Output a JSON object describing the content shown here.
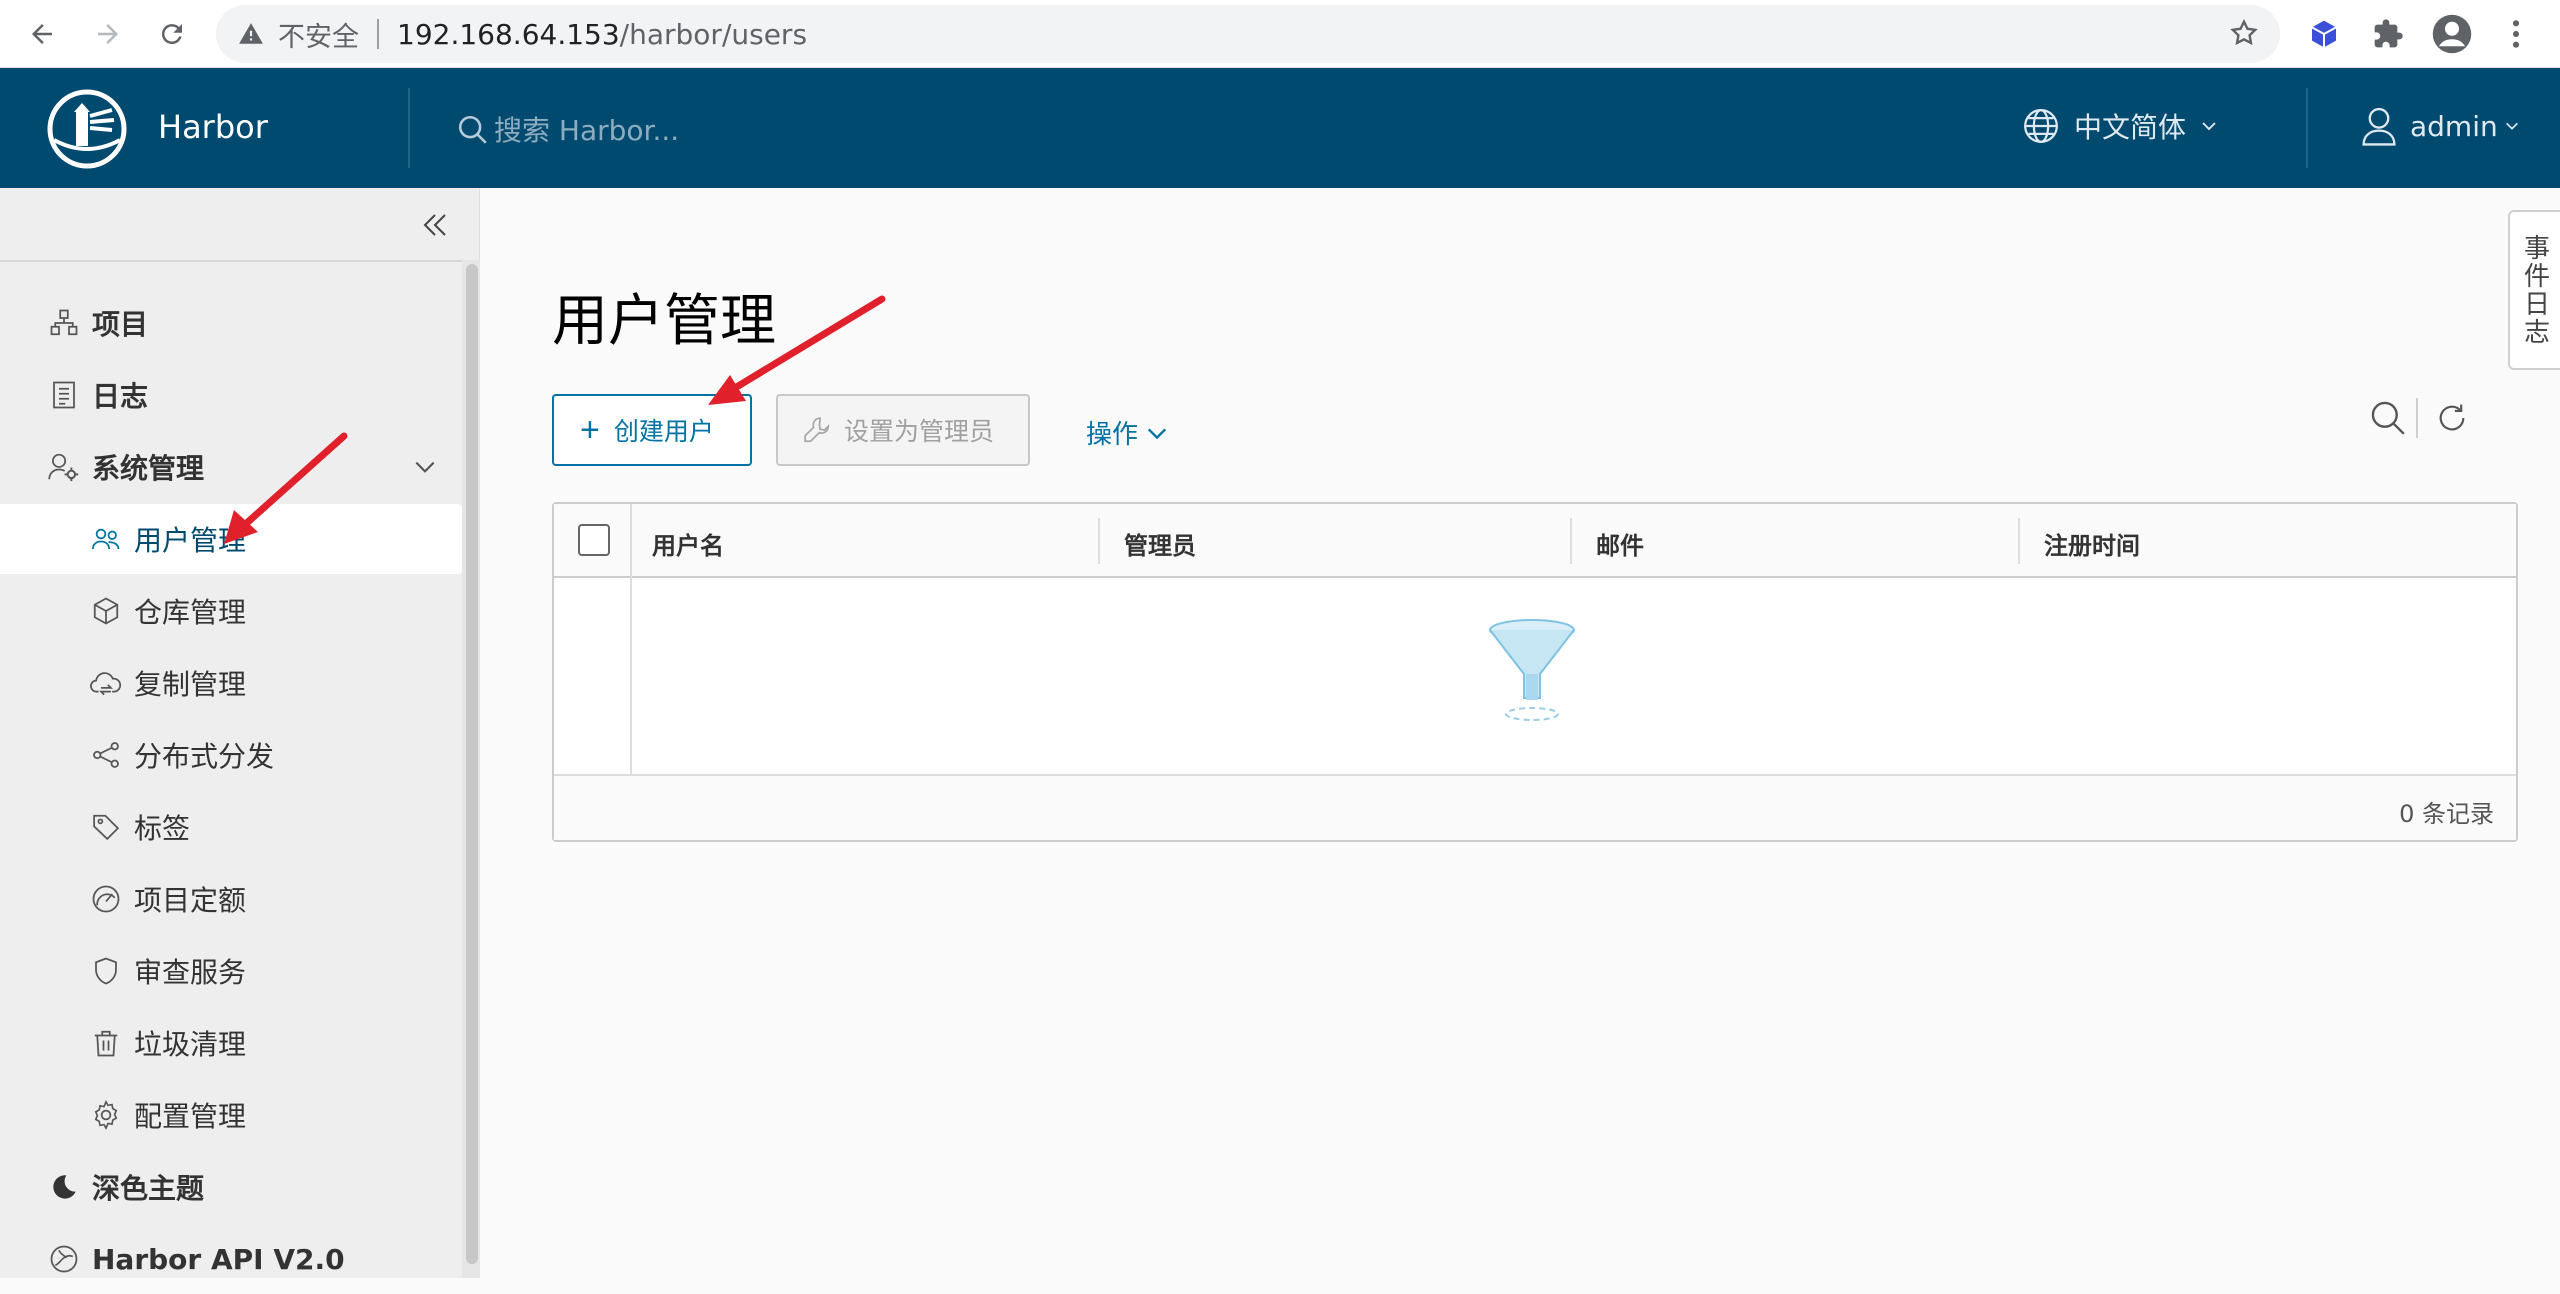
{
  "browser": {
    "security_label": "不安全",
    "url_host": "192.168.64.153",
    "url_path": "/harbor/users"
  },
  "header": {
    "brand": "Harbor",
    "search_placeholder": "搜索 Harbor...",
    "language": "中文简体",
    "username": "admin"
  },
  "sidebar": {
    "projects": "项目",
    "logs": "日志",
    "administration": "系统管理",
    "sub_items": {
      "users": "用户管理",
      "registries": "仓库管理",
      "replications": "复制管理",
      "distributions": "分布式分发",
      "labels": "标签",
      "quotas": "项目定额",
      "interrogation": "审查服务",
      "gc": "垃圾清理",
      "config": "配置管理"
    },
    "dark_theme": "深色主题",
    "api": "Harbor API V2.0"
  },
  "main": {
    "title": "用户管理",
    "create_user": "创建用户",
    "set_admin": "设置为管理员",
    "actions": "操作",
    "columns": [
      "用户名",
      "管理员",
      "邮件",
      "注册时间"
    ],
    "footer_count": "0 条记录"
  },
  "event_log_tab": "事件日志",
  "colors": {
    "header_bg": "#004a70",
    "accent": "#0072a3",
    "annotation_arrow": "#e0202a"
  }
}
